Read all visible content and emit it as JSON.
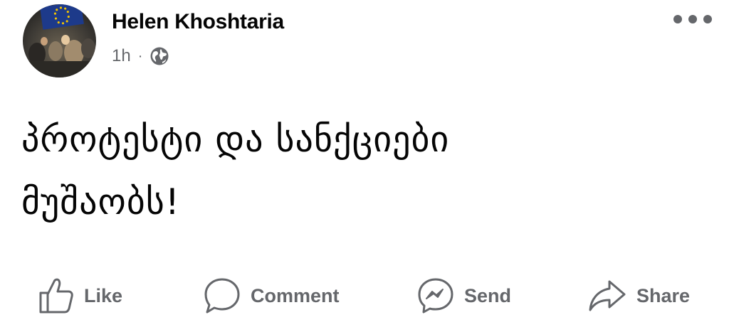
{
  "post": {
    "author": {
      "name": "Helen Khoshtaria",
      "avatar_icon": "profile-photo-with-eu-flag"
    },
    "meta": {
      "time": "1h",
      "separator": "·",
      "privacy_icon": "globe-icon"
    },
    "more_icon": "more-horizontal-icon",
    "text": "პროტესტი და სანქციები\nმუშაობს!",
    "actions": [
      {
        "label": "Like",
        "icon": "like-icon"
      },
      {
        "label": "Comment",
        "icon": "comment-icon"
      },
      {
        "label": "Send",
        "icon": "messenger-icon"
      },
      {
        "label": "Share",
        "icon": "share-icon"
      }
    ]
  },
  "colors": {
    "text_primary": "#050505",
    "text_secondary": "#65676b",
    "background": "#ffffff",
    "eu_blue": "#1d3a8a",
    "eu_gold": "#f2c300"
  }
}
